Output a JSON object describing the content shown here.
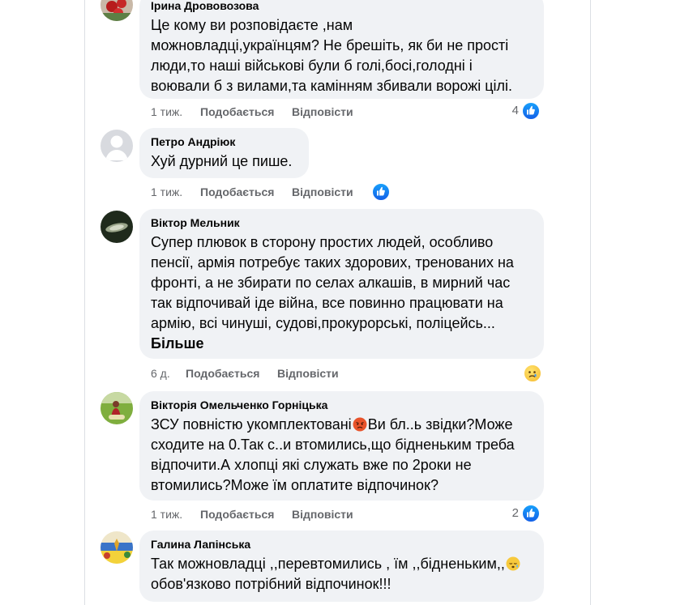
{
  "comments": [
    {
      "author": "Ірина Дрововозова",
      "text": "Це кому ви розповідаєте ,нам\nможновладці,українцям? Не брешіть, як би не прості\nлюди,то наші військові були б голі,босі,голодні і\nвоювали б з вилами,та камінням збивали ворожі цілі.",
      "time": "1 тиж.",
      "like_label": "Подобається",
      "reply_label": "Відповісти",
      "reaction_count": "4",
      "reaction": "like-icon"
    },
    {
      "author": "Петро Андріюк",
      "text": "Хуй дурний це пише.",
      "time": "1 тиж.",
      "like_label": "Подобається",
      "reply_label": "Відповісти",
      "reaction_count": "",
      "reaction": "like-icon"
    },
    {
      "author": "Віктор Мельник",
      "text": "Супер плювок в сторону простих людей, особливо\nпенсії, армія потребує таких здорових, тренованих на\nфронті, а не збирати по селах алкашів, в мирний час\nтак відпочивай іде війна, все повинно працювати на\nармію, всі чинуші, судові,прокурорські, поліцейсь...",
      "more_label": "Більше",
      "time": "6 д.",
      "like_label": "Подобається",
      "reply_label": "Відповісти",
      "reaction_count": "",
      "reaction": "sad-icon"
    },
    {
      "author": "Вікторія Омельченко Горніцька",
      "text_before_emoji": "ЗСУ повністю укомплектовані",
      "text_after_emoji": "Ви бл..ь звідки?Може\nсходите на 0.Так с..и втомились,що бідненьким треба\nвідпочити.А хлопці які служать вже по 2роки не\nвтомились?Може їм оплатите відпочинок?",
      "emoji": "angry-face-icon",
      "time": "1 тиж.",
      "like_label": "Подобається",
      "reply_label": "Відповісти",
      "reaction_count": "2",
      "reaction": "like-icon"
    },
    {
      "author": "Галина Лапінська",
      "text_before_emoji": "Так можновладці ,,перевтомились , їм ,,бідненьким,,",
      "text_after_emoji": "\nобов'язково потрібний відпочинок!!!",
      "emoji": "sleepy-face-icon"
    }
  ],
  "colors": {
    "bubble": "#f0f2f5",
    "meta": "#65676b",
    "like_blue": "#1877f2"
  }
}
